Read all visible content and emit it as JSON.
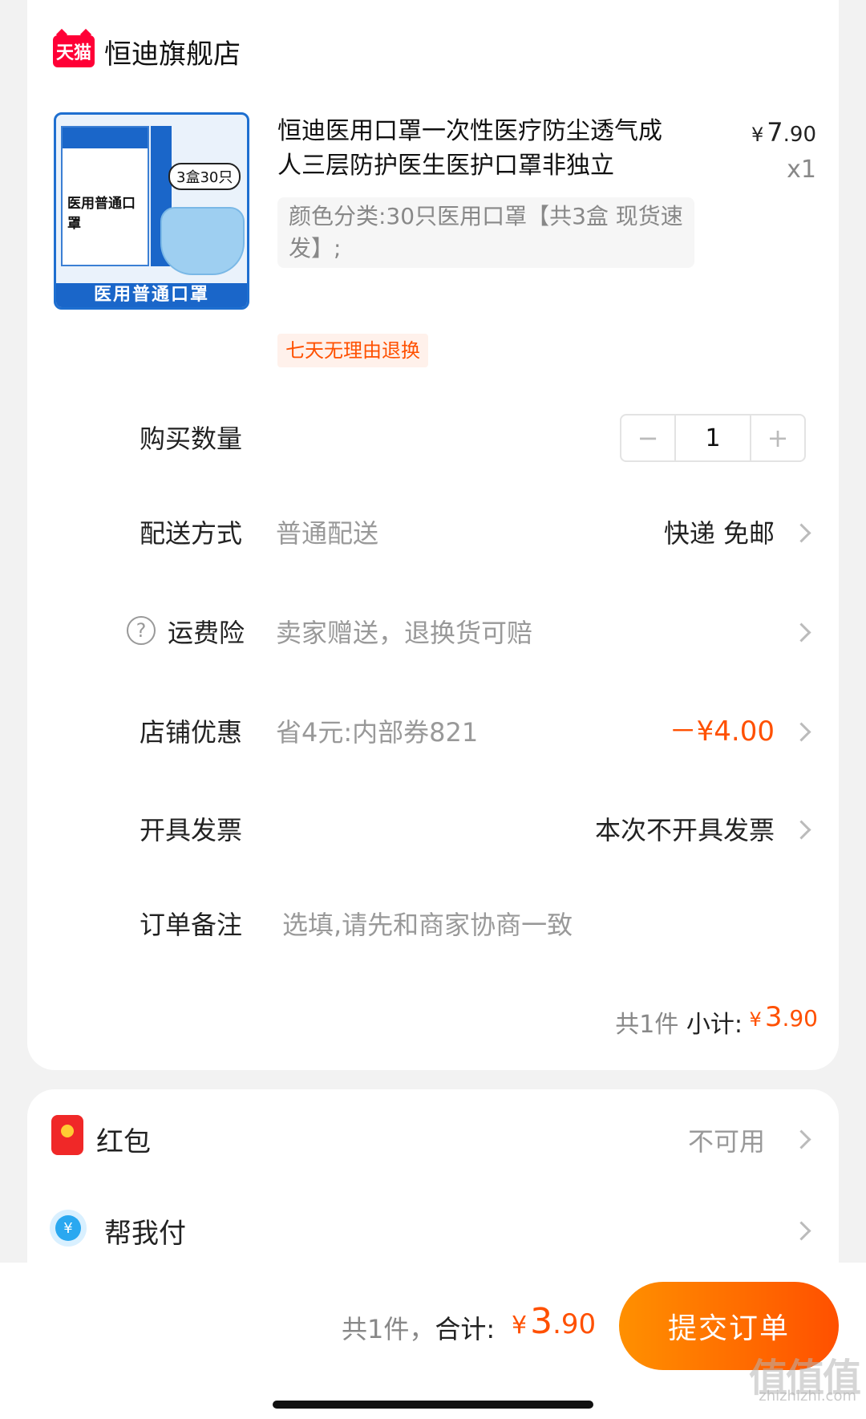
{
  "store": {
    "logo_text": "天猫",
    "name": "恒迪旗舰店"
  },
  "product": {
    "image_box_text": "医用普通口罩",
    "image_pill": "3盒30只",
    "image_banner": "医用普通口罩",
    "title": "恒迪医用口罩一次性医疗防尘透气成人三层防护医生医护口罩非独立",
    "price_currency": "¥",
    "price_int": "7",
    "price_dec": ".90",
    "quantity_label": "x1",
    "sku": "颜色分类:30只医用口罩【共3盒 现货速发】;",
    "return_tag": "七天无理由退换"
  },
  "rows": {
    "quantity": {
      "label": "购买数量",
      "minus": "−",
      "value": "1",
      "plus": "+"
    },
    "delivery": {
      "label": "配送方式",
      "sub": "普通配送",
      "value": "快递 免邮"
    },
    "insurance": {
      "label": "运费险",
      "sub": "卖家赠送，退换货可赔",
      "icon": "?"
    },
    "discount": {
      "label": "店铺优惠",
      "sub": "省4元:内部券821",
      "value": "－¥4.00"
    },
    "invoice": {
      "label": "开具发票",
      "value": "本次不开具发票"
    },
    "remark": {
      "label": "订单备注",
      "placeholder": "选填,请先和商家协商一致"
    }
  },
  "subtotal": {
    "count": "共1件",
    "label": "小计:",
    "currency": "¥",
    "int": "3",
    "dec": ".90"
  },
  "extras": {
    "hongbao": {
      "label": "红包",
      "value": "不可用"
    },
    "helppay": {
      "label": "帮我付",
      "icon": "¥"
    }
  },
  "bottom": {
    "count": "共1件，",
    "label": "合计:",
    "currency": "¥",
    "int": "3",
    "dec": ".90",
    "submit": "提交订单"
  },
  "watermark": {
    "text": "值值值",
    "url": "zhizhizhi.com"
  },
  "colors": {
    "accent": "#ff5000",
    "tmall_red": "#ff0036",
    "submit_gradient": [
      "#ff9000",
      "#ff5000"
    ]
  },
  "icons": [
    "tmall-logo-icon",
    "help-circle-icon",
    "chevron-right-icon",
    "red-envelope-icon",
    "yuan-coin-icon"
  ]
}
